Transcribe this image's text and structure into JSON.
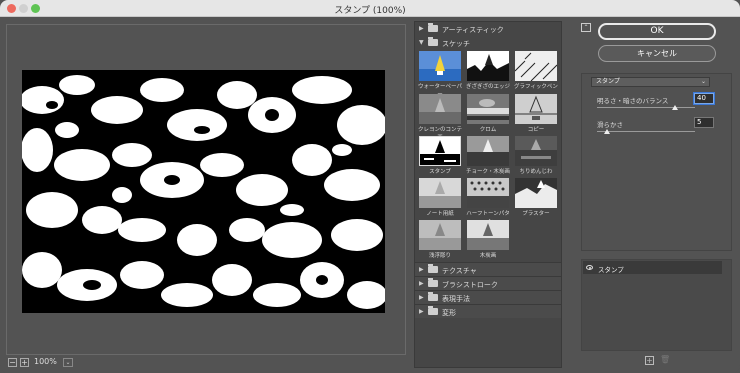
{
  "window": {
    "title": "スタンプ (100%)"
  },
  "preview": {
    "zoom_out": "−",
    "zoom_in": "+",
    "zoom_level": "100%",
    "zoom_menu": "⌄"
  },
  "gallery": {
    "groups": [
      {
        "label": "アーティスティック",
        "expanded": false
      },
      {
        "label": "スケッチ",
        "expanded": true
      },
      {
        "label": "テクスチャ",
        "expanded": false
      },
      {
        "label": "ブラシストローク",
        "expanded": false
      },
      {
        "label": "表現手法",
        "expanded": false
      },
      {
        "label": "変形",
        "expanded": false
      }
    ],
    "sketch_filters": [
      {
        "label": "ウォーターペーパー",
        "selected": false
      },
      {
        "label": "ぎざぎざのエッジ",
        "selected": false
      },
      {
        "label": "グラフィックペン",
        "selected": false
      },
      {
        "label": "クレヨンのコンテ画",
        "selected": false
      },
      {
        "label": "クロム",
        "selected": false
      },
      {
        "label": "コピー",
        "selected": false
      },
      {
        "label": "スタンプ",
        "selected": true
      },
      {
        "label": "チョーク・木炭画",
        "selected": false
      },
      {
        "label": "ちりめんじわ",
        "selected": false
      },
      {
        "label": "ノート用紙",
        "selected": false
      },
      {
        "label": "ハーフトーンパターン",
        "selected": false
      },
      {
        "label": "プラスター",
        "selected": false
      },
      {
        "label": "浅浮彫り",
        "selected": false
      },
      {
        "label": "木炭画",
        "selected": false
      }
    ]
  },
  "dialog": {
    "expand_icon": "⌃",
    "ok": "OK",
    "cancel": "キャンセル"
  },
  "settings": {
    "filter_select": "スタンプ",
    "params": [
      {
        "label": "明るさ・暗さのバランス",
        "value": "40",
        "level": 0.8
      },
      {
        "label": "滑らかさ",
        "value": "5",
        "level": 0.1
      }
    ]
  },
  "layers": {
    "items": [
      "スタンプ"
    ],
    "new_icon": "+",
    "delete_icon": "🗑"
  },
  "colors": {
    "bg": "#535353",
    "panel": "#464646",
    "selection": "#3b78d8"
  }
}
